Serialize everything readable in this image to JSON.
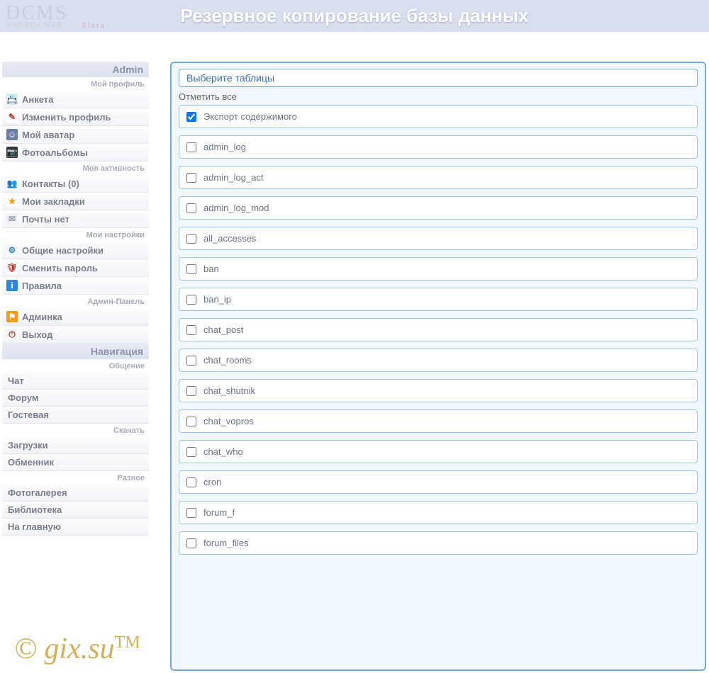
{
  "logo": {
    "main": "DCMS",
    "sub": "WAP/PDA/WEB",
    "extra": "Flera"
  },
  "header": {
    "title": "Резервное копирование базы данных"
  },
  "sidebar": {
    "sections": [
      {
        "header": "Admin",
        "groups": [
          {
            "sub": "Мой профиль",
            "items": [
              {
                "label": "Анкета",
                "icon": "profile-icon",
                "bg": "#dfe8f6",
                "fg": "#3a6fb5",
                "glyph": "📇"
              },
              {
                "label": "Изменить профиль",
                "icon": "edit-icon",
                "bg": "#fff",
                "fg": "#c0392b",
                "glyph": "✎"
              },
              {
                "label": "Мой аватар",
                "icon": "avatar-icon",
                "bg": "#6b7ea6",
                "fg": "#fff",
                "glyph": "☺"
              },
              {
                "label": "Фотоальбомы",
                "icon": "camera-icon",
                "bg": "#333",
                "fg": "#fff",
                "glyph": "📷"
              }
            ]
          },
          {
            "sub": "Моя активность",
            "items": [
              {
                "label": "Контакты (0)",
                "icon": "contacts-icon",
                "bg": "#fff",
                "fg": "#27ae60",
                "glyph": "👥"
              },
              {
                "label": "Мои закладки",
                "icon": "bookmarks-icon",
                "bg": "#fff",
                "fg": "#f39c12",
                "glyph": "★"
              },
              {
                "label": "Почты нет",
                "icon": "mail-icon",
                "bg": "#eef0f5",
                "fg": "#9aa0b0",
                "glyph": "✉"
              }
            ]
          },
          {
            "sub": "Мои настройки",
            "items": [
              {
                "label": "Общие настройки",
                "icon": "gear-icon",
                "bg": "#fff",
                "fg": "#2e86de",
                "glyph": "⚙"
              },
              {
                "label": "Сменить пароль",
                "icon": "shield-icon",
                "bg": "#fff",
                "fg": "#c0392b",
                "glyph": "🛡"
              },
              {
                "label": "Правила",
                "icon": "info-icon",
                "bg": "#2e86de",
                "fg": "#fff",
                "glyph": "i"
              }
            ]
          },
          {
            "sub": "Админ-Панель",
            "items": [
              {
                "label": "Админка",
                "icon": "admin-icon",
                "bg": "#f39c12",
                "fg": "#fff",
                "glyph": "⚑"
              },
              {
                "label": "Выход",
                "icon": "power-icon",
                "bg": "#fff",
                "fg": "#c0392b",
                "glyph": "⏻"
              }
            ]
          }
        ]
      },
      {
        "header": "Навигация",
        "groups": [
          {
            "sub": "Общение",
            "items": [
              {
                "label": "Чат"
              },
              {
                "label": "Форум"
              },
              {
                "label": "Гостевая"
              }
            ]
          },
          {
            "sub": "Скачать",
            "items": [
              {
                "label": "Загрузки"
              },
              {
                "label": "Обменник"
              }
            ]
          },
          {
            "sub": "Разное",
            "items": [
              {
                "label": "Фотогалерея"
              },
              {
                "label": "Библиотека"
              },
              {
                "label": "На главную"
              }
            ]
          }
        ]
      }
    ]
  },
  "panel": {
    "legend": "Выберите таблицы",
    "mark_all": "Отметить все",
    "export_content": {
      "label": "Экспорт содержимого",
      "checked": true
    },
    "tables": [
      "admin_log",
      "admin_log_act",
      "admin_log_mod",
      "all_accesses",
      "ban",
      "ban_ip",
      "chat_post",
      "chat_rooms",
      "chat_shutnik",
      "chat_vopros",
      "chat_who",
      "cron",
      "forum_f",
      "forum_files"
    ]
  },
  "watermark": {
    "text": "© gix.su",
    "tm": "TM"
  }
}
